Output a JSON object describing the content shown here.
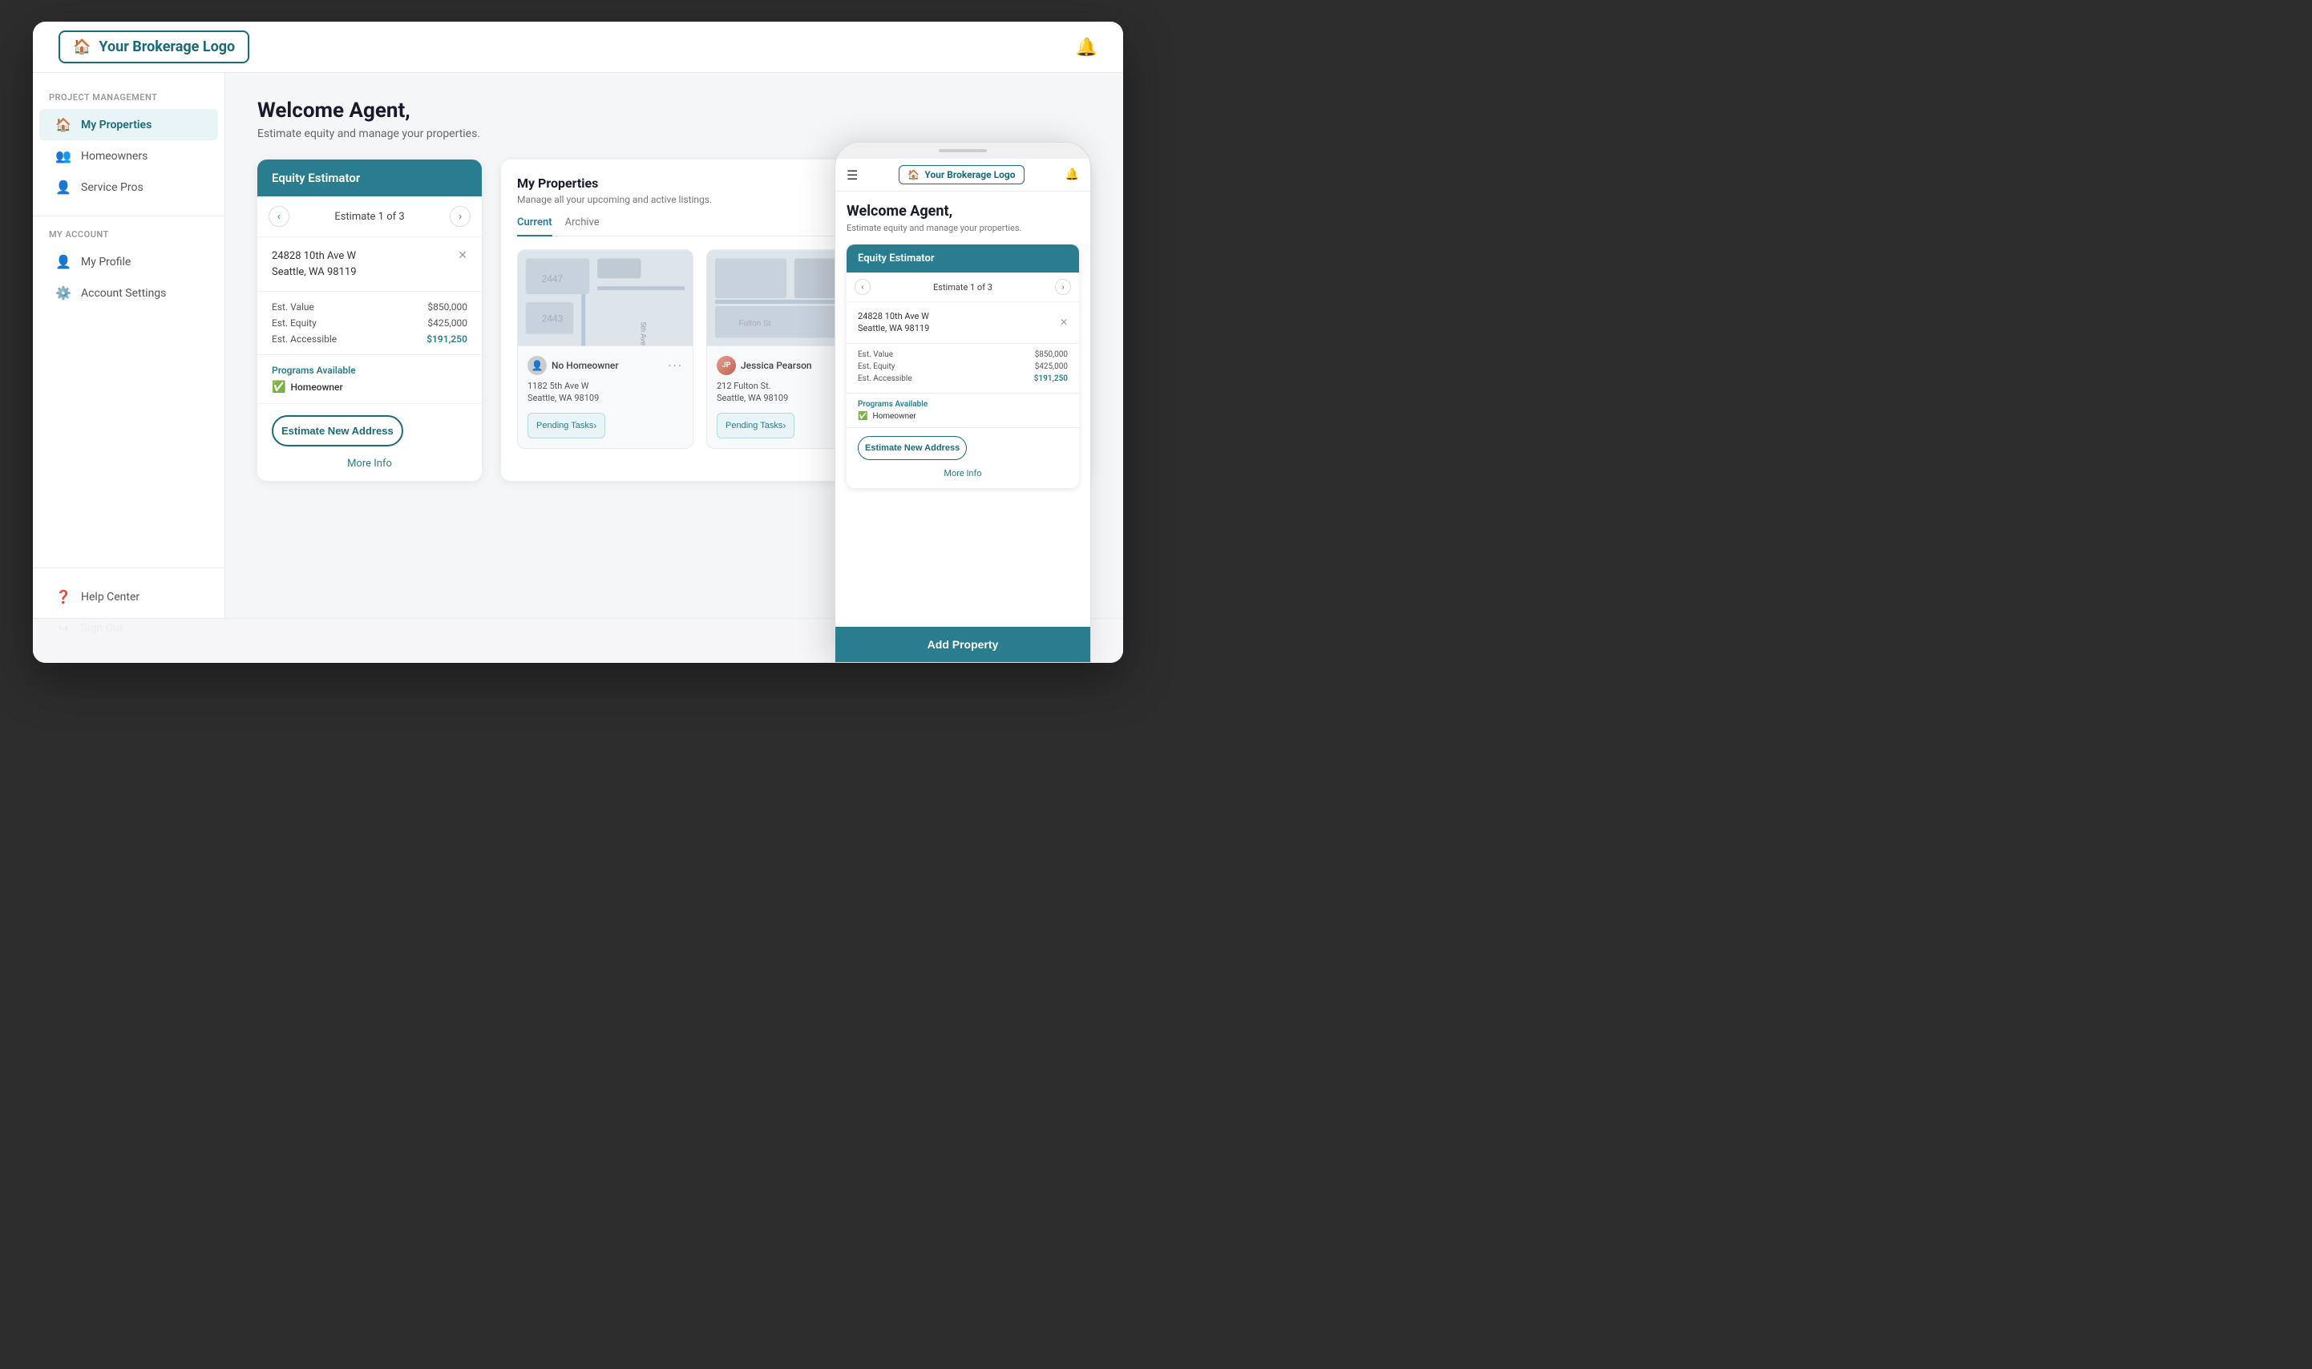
{
  "topBar": {
    "logo": "Your Brokerage Logo",
    "bell": "🔔"
  },
  "sidebar": {
    "projectManagementLabel": "Project Management",
    "myAccountLabel": "My Account",
    "items": [
      {
        "id": "my-properties",
        "label": "My Properties",
        "icon": "🏠",
        "active": true
      },
      {
        "id": "homeowners",
        "label": "Homeowners",
        "icon": "👥",
        "active": false
      },
      {
        "id": "service-pros",
        "label": "Service Pros",
        "icon": "👤",
        "active": false
      }
    ],
    "accountItems": [
      {
        "id": "my-profile",
        "label": "My Profile",
        "icon": "⚙️"
      },
      {
        "id": "account-settings",
        "label": "Account Settings",
        "icon": "⚙️"
      }
    ],
    "bottomItems": [
      {
        "id": "help-center",
        "label": "Help Center",
        "icon": "❓"
      },
      {
        "id": "sign-out",
        "label": "Sign Out",
        "icon": "↪"
      }
    ]
  },
  "mainContent": {
    "welcomeTitle": "Welcome Agent,",
    "welcomeSub": "Estimate equity and manage your properties.",
    "equityEstimator": {
      "header": "Equity Estimator",
      "navLabel": "Estimate 1 of 3",
      "address": {
        "line1": "24828 10th Ave W",
        "line2": "Seattle, WA 98119"
      },
      "estValue": "$850,000",
      "estEquity": "$425,000",
      "estAccessible": "$191,250",
      "estValueLabel": "Est. Value",
      "estEquityLabel": "Est. Equity",
      "estAccessibleLabel": "Est. Accessible",
      "programsAvailableLabel": "Programs Available",
      "homeownerLabel": "Homeowner",
      "estimateNewAddressBtn": "Estimate New Address",
      "moreInfoLink": "More Info"
    },
    "propertiesPanel": {
      "title": "My Properties",
      "subtitle": "Manage all your upcoming and active listings.",
      "tabs": [
        {
          "label": "Current",
          "active": true
        },
        {
          "label": "Archive",
          "active": false
        }
      ],
      "properties": [
        {
          "id": "prop-1",
          "owner": "No Homeowner",
          "ownerType": "none",
          "addressLine1": "1182 5th Ave W",
          "addressLine2": "Seattle, WA 98109",
          "pendingTasksLabel": "Pending Tasks"
        },
        {
          "id": "prop-2",
          "owner": "Jessica Pearson",
          "ownerType": "person",
          "addressLine1": "212 Fulton St.",
          "addressLine2": "Seattle, WA 98109",
          "pendingTasksLabel": "Pending Tasks"
        }
      ]
    },
    "addPropertyBtn": "Add Property"
  },
  "mobile": {
    "logo": "Your Brokerage Logo",
    "welcomeTitle": "Welcome Agent,",
    "welcomeSub": "Estimate equity and manage your properties.",
    "equityEstimator": {
      "header": "Equity Estimator",
      "navLabel": "Estimate 1 of 3",
      "address": {
        "line1": "24828 10th Ave W",
        "line2": "Seattle, WA 98119"
      },
      "estValue": "$850,000",
      "estEquity": "$425,000",
      "estAccessible": "$191,250",
      "estValueLabel": "Est. Value",
      "estEquityLabel": "Est. Equity",
      "estAccessibleLabel": "Est. Accessible",
      "programsAvailableLabel": "Programs Available",
      "homeownerLabel": "Homeowner",
      "estimateNewAddressBtn": "Estimate New Address",
      "moreInfoLink": "More Info"
    },
    "addPropertyBtn": "Add Property"
  }
}
